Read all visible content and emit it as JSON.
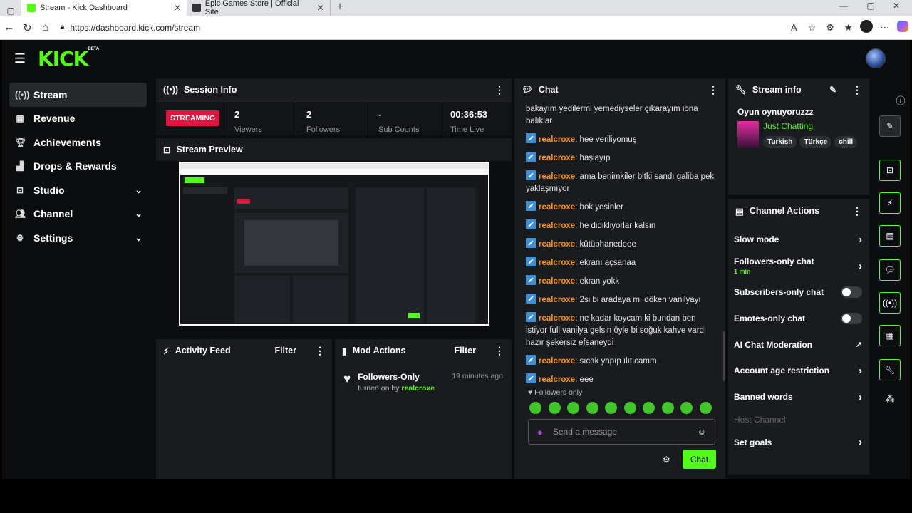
{
  "browser": {
    "tabs": [
      {
        "title": "Stream - Kick Dashboard"
      },
      {
        "title": "Epic Games Store | Official Site"
      }
    ],
    "url": "https://dashboard.kick.com/stream"
  },
  "app": {
    "logo": "KICK",
    "beta": "BETA"
  },
  "sidebar": {
    "items": [
      {
        "label": "Stream",
        "icon": "broadcast-icon"
      },
      {
        "label": "Revenue",
        "icon": "chart-icon"
      },
      {
        "label": "Achievements",
        "icon": "trophy-icon"
      },
      {
        "label": "Drops & Rewards",
        "icon": "drops-icon"
      },
      {
        "label": "Studio",
        "icon": "studio-icon"
      },
      {
        "label": "Channel",
        "icon": "channel-icon"
      },
      {
        "label": "Settings",
        "icon": "gear-icon"
      }
    ]
  },
  "session": {
    "title": "Session Info",
    "status": "STREAMING",
    "stats": [
      {
        "value": "2",
        "label": "Viewers"
      },
      {
        "value": "2",
        "label": "Followers"
      },
      {
        "value": "-",
        "label": "Sub Counts"
      },
      {
        "value": "00:36:53",
        "label": "Time Live"
      }
    ]
  },
  "preview": {
    "title": "Stream Preview"
  },
  "activity": {
    "title": "Activity Feed",
    "filter": "Filter"
  },
  "mod": {
    "title": "Mod Actions",
    "filter": "Filter",
    "entry": {
      "action": "Followers-Only",
      "time": "19 minutes ago",
      "text": "turned on by",
      "user": "realcroxe"
    }
  },
  "chat": {
    "title": "Chat",
    "partial": "bakayım yedilermi yemediyseler çıkarayım ibna balıklar",
    "messages": [
      {
        "user": "realcroxe",
        "text": "hee veriliyomuş"
      },
      {
        "user": "realcroxe",
        "text": "haşlayıp"
      },
      {
        "user": "realcroxe",
        "text": "ama benimkiler bitki sandı galiba pek yaklaşmıyor"
      },
      {
        "user": "realcroxe",
        "text": "bok yesinler"
      },
      {
        "user": "realcroxe",
        "text": "he didikliyorlar kalsın"
      },
      {
        "user": "realcroxe",
        "text": "kütüphanedeee"
      },
      {
        "user": "realcroxe",
        "text": "ekranı açsanaa"
      },
      {
        "user": "realcroxe",
        "text": "ekran yokk"
      },
      {
        "user": "realcroxe",
        "text": "2si bi aradaya mı döken vanilyayı"
      },
      {
        "user": "realcroxe",
        "text": "ne kadar koycam ki bundan ben istiyor full vanilya gelsin öyle bi soğuk kahve vardı hazır şekersiz efsaneydi"
      },
      {
        "user": "realcroxe",
        "text": "sıcak yapıp ılıtıcamm"
      },
      {
        "user": "realcroxe",
        "text": "eee"
      }
    ],
    "mode": "Followers only",
    "placeholder": "Send a message",
    "send": "Chat"
  },
  "streaminfo": {
    "title": "Stream info",
    "stream_title": "Oyun oynuyoruzzz",
    "category": "Just Chatting",
    "tags": [
      "Turkish",
      "Türkçe",
      "chill"
    ]
  },
  "channel_actions": {
    "title": "Channel Actions",
    "items": [
      {
        "label": "Slow mode",
        "control": "chevron"
      },
      {
        "label": "Followers-only chat",
        "sub": "1 min",
        "control": "chevron"
      },
      {
        "label": "Subscribers-only chat",
        "control": "toggle",
        "on": false
      },
      {
        "label": "Emotes-only chat",
        "control": "toggle",
        "on": false
      },
      {
        "label": "AI Chat Moderation",
        "control": "external"
      },
      {
        "label": "Account age restriction",
        "control": "chevron"
      },
      {
        "label": "Banned words",
        "control": "chevron"
      },
      {
        "label": "Host Channel",
        "control": "none",
        "disabled": true
      },
      {
        "label": "Set goals",
        "control": "chevron"
      }
    ]
  },
  "colors": {
    "brand": "#53fc18",
    "live": "#e0143c",
    "username": "#f7931a"
  }
}
